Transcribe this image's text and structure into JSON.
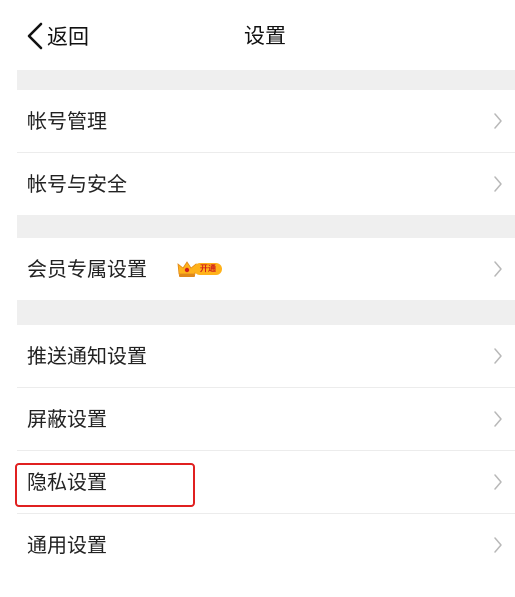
{
  "header": {
    "back_label": "返回",
    "title": "设置"
  },
  "settings_groups": [
    {
      "items": [
        {
          "label": "帐号管理"
        },
        {
          "label": "帐号与安全"
        }
      ]
    },
    {
      "items": [
        {
          "label": "会员专属设置",
          "badge": {
            "text": "开通",
            "icon": "crown-icon"
          }
        }
      ]
    },
    {
      "items": [
        {
          "label": "推送通知设置"
        },
        {
          "label": "屏蔽设置"
        },
        {
          "label": "隐私设置",
          "highlighted": true
        },
        {
          "label": "通用设置"
        }
      ]
    }
  ],
  "colors": {
    "highlight": "#e02020",
    "group_gap": "#efefef",
    "badge": "#ffb21a"
  },
  "icons": {
    "back": "chevron-left-icon",
    "row_arrow": "chevron-right-icon"
  }
}
